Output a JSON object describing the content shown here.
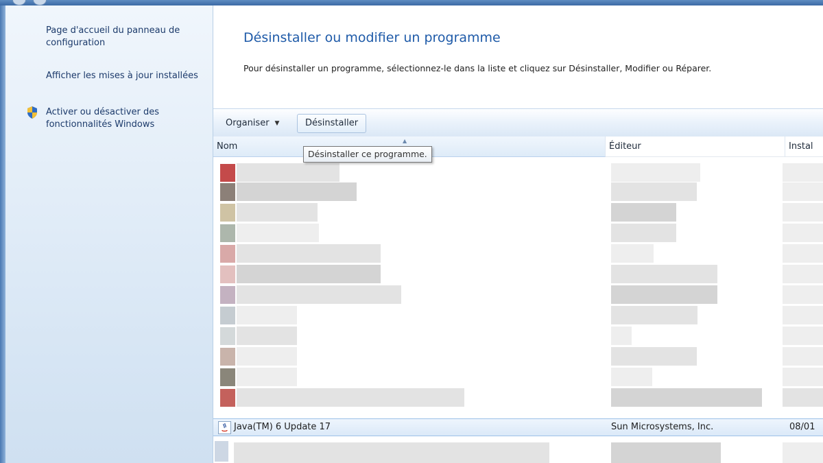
{
  "sidebar": {
    "links": [
      {
        "label": "Page d'accueil du panneau de configuration"
      },
      {
        "label": "Afficher les mises à jour installées"
      },
      {
        "label": "Activer ou désactiver des fonctionnalités Windows",
        "icon": "shield-icon"
      }
    ]
  },
  "main": {
    "title": "Désinstaller ou modifier un programme",
    "description": "Pour désinstaller un programme, sélectionnez-le dans la liste et cliquez sur Désinstaller, Modifier ou Réparer."
  },
  "toolbar": {
    "organize_label": "Organiser",
    "uninstall_label": "Désinstaller",
    "tooltip": "Désinstaller ce programme."
  },
  "columns": {
    "name": "Nom",
    "publisher": "Éditeur",
    "installed": "Instal"
  },
  "programs": [
    {
      "name": "Java(TM) 6 Update 17",
      "publisher": "Sun Microsystems, Inc.",
      "installed": "08/01"
    }
  ],
  "colors": {
    "title_blue": "#1e5aa8",
    "sidebar_link": "#1c3a6b",
    "selection": "#dbe9f8"
  }
}
